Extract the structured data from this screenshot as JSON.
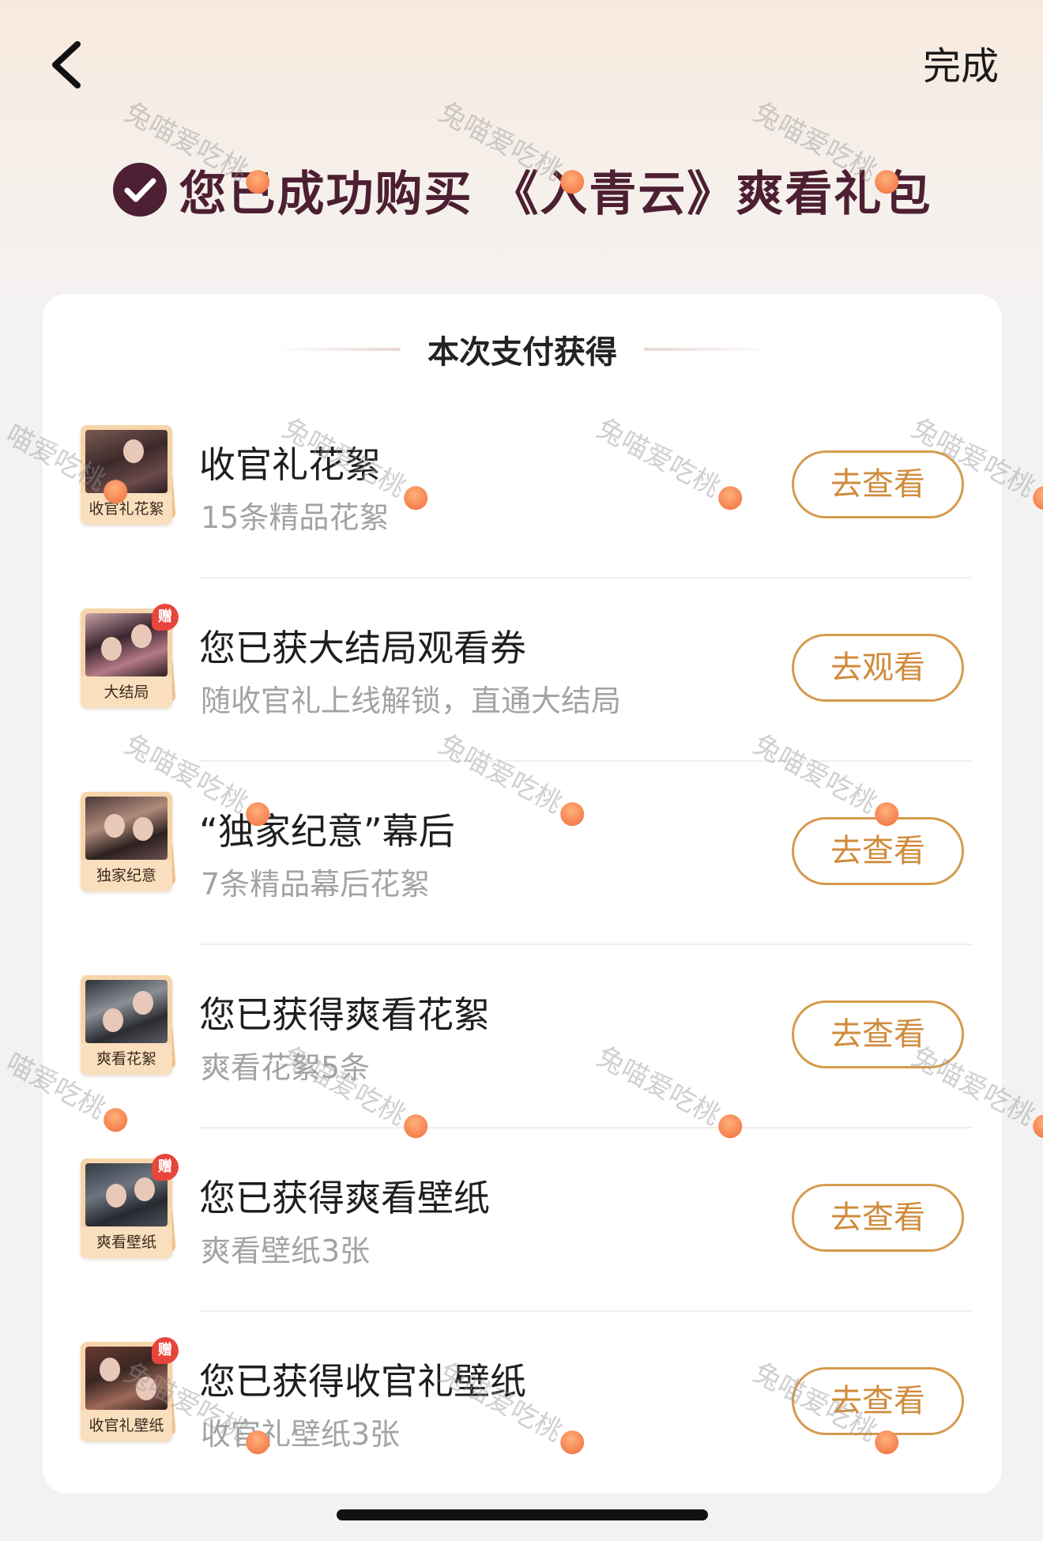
{
  "nav": {
    "done_label": "完成"
  },
  "header": {
    "success_text": "您已成功购买 《入青云》爽看礼包"
  },
  "section": {
    "title": "本次支付获得"
  },
  "items": [
    {
      "title": "收官礼花絮",
      "subtitle": "15条精品花絮",
      "tag": "收官礼花絮",
      "gift": "",
      "button": "去查看"
    },
    {
      "title": "您已获大结局观看券",
      "subtitle": "随收官礼上线解锁，直通大结局",
      "tag": "大结局",
      "gift": "赠",
      "button": "去观看"
    },
    {
      "title": "“独家纪意”幕后",
      "subtitle": "7条精品幕后花絮",
      "tag": "独家纪意",
      "gift": "",
      "button": "去查看"
    },
    {
      "title": "您已获得爽看花絮",
      "subtitle": "爽看花絮5条",
      "tag": "爽看花絮",
      "gift": "",
      "button": "去查看"
    },
    {
      "title": "您已获得爽看壁纸",
      "subtitle": "爽看壁纸3张",
      "tag": "爽看壁纸",
      "gift": "赠",
      "button": "去查看"
    },
    {
      "title": "您已获得收官礼壁纸",
      "subtitle": "收官礼壁纸3张",
      "tag": "收官礼壁纸",
      "gift": "赠",
      "button": "去查看"
    }
  ],
  "watermark": {
    "text": "兔喵爱吃桃",
    "truncated_text": "喵爱吃桃"
  },
  "colors": {
    "title_color": "#4d1f32",
    "button_accent": "#d69a4e",
    "gift_badge": "#e8463c"
  },
  "icons": [
    "back-chevron-icon",
    "checkmark-icon",
    "peach-icon"
  ]
}
